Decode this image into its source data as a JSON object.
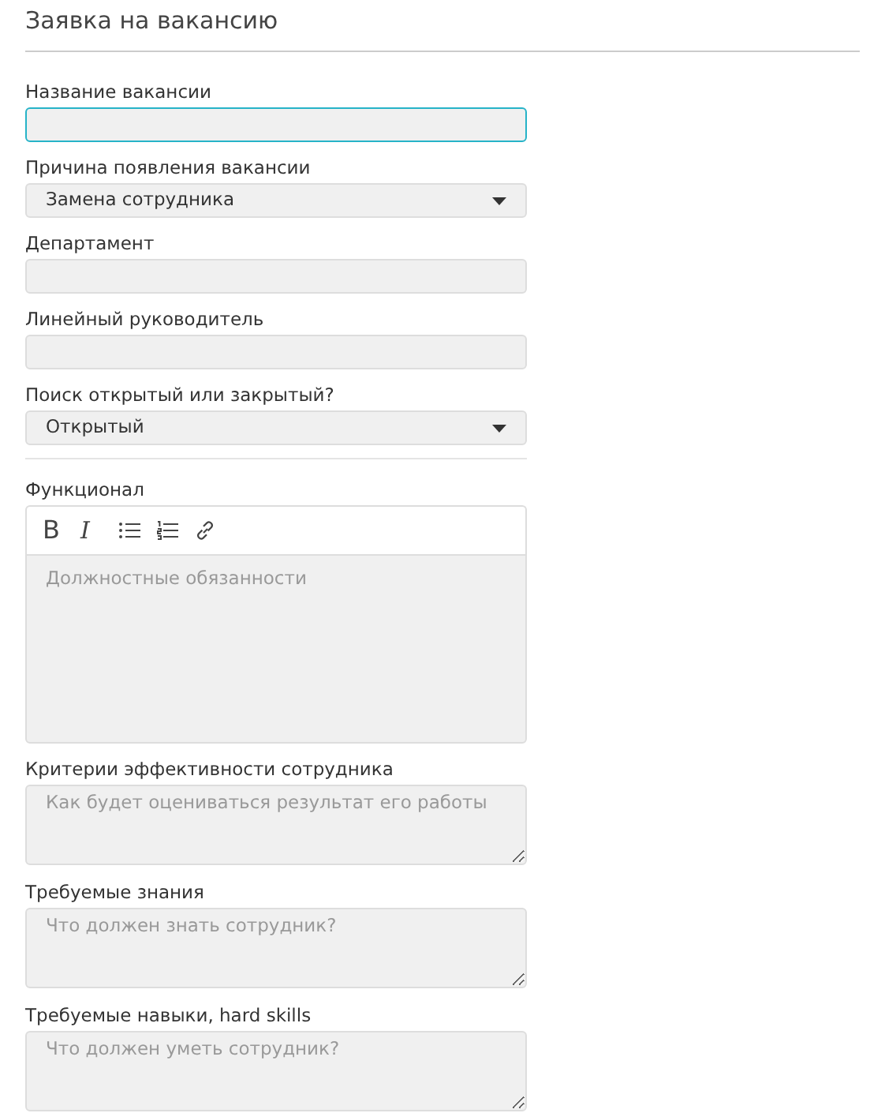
{
  "title": "Заявка на вакансию",
  "sections": [
    {
      "fields": [
        {
          "kind": "text",
          "label": "Название вакансии",
          "focused": true
        },
        {
          "kind": "select",
          "label": "Причина появления вакансии",
          "value": "Замена сотрудника"
        },
        {
          "kind": "text",
          "label": "Департамент",
          "focused": false
        },
        {
          "kind": "text",
          "label": "Линейный руководитель",
          "focused": false
        },
        {
          "kind": "select",
          "label": "Поиск открытый или закрытый?",
          "value": "Открытый"
        }
      ]
    },
    {
      "fields": [
        {
          "kind": "editor",
          "label": "Функционал",
          "placeholder": "Должностные обязанности",
          "tools": [
            {
              "kind": "bold",
              "label": "B"
            },
            {
              "kind": "italic",
              "label": "I"
            },
            {
              "kind": "bullets"
            },
            {
              "kind": "numbers"
            },
            {
              "kind": "link"
            }
          ]
        },
        {
          "kind": "textarea",
          "label": "Критерии эффективности сотрудника",
          "placeholder": "Как будет оцениваться результат его работы"
        },
        {
          "kind": "textarea",
          "label": "Требуемые знания",
          "placeholder": "Что должен знать сотрудник?"
        },
        {
          "kind": "textarea",
          "label": "Требуемые навыки, hard skills",
          "placeholder": "Что должен уметь сотрудник?"
        }
      ]
    }
  ]
}
